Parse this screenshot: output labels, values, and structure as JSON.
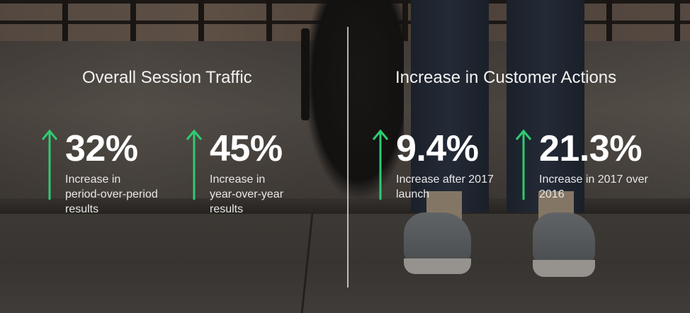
{
  "left_section": {
    "title": "Overall Session Traffic",
    "stats": [
      {
        "value": "32%",
        "description": "Increase in\nperiod-over-period\nresults",
        "trend": "up"
      },
      {
        "value": "45%",
        "description": "Increase in\nyear-over-year\nresults",
        "trend": "up"
      }
    ]
  },
  "right_section": {
    "title": "Increase in Customer Actions",
    "stats": [
      {
        "value": "9.4%",
        "description": "Increase after 2017\nlaunch",
        "trend": "up"
      },
      {
        "value": "21.3%",
        "description": "Increase in 2017 over\n2016",
        "trend": "up"
      }
    ]
  },
  "icons": {
    "trend": "arrow-up-icon"
  },
  "colors": {
    "arrow": "#2ecc71",
    "text": "#ffffff",
    "divider": "#e6e6e6"
  }
}
